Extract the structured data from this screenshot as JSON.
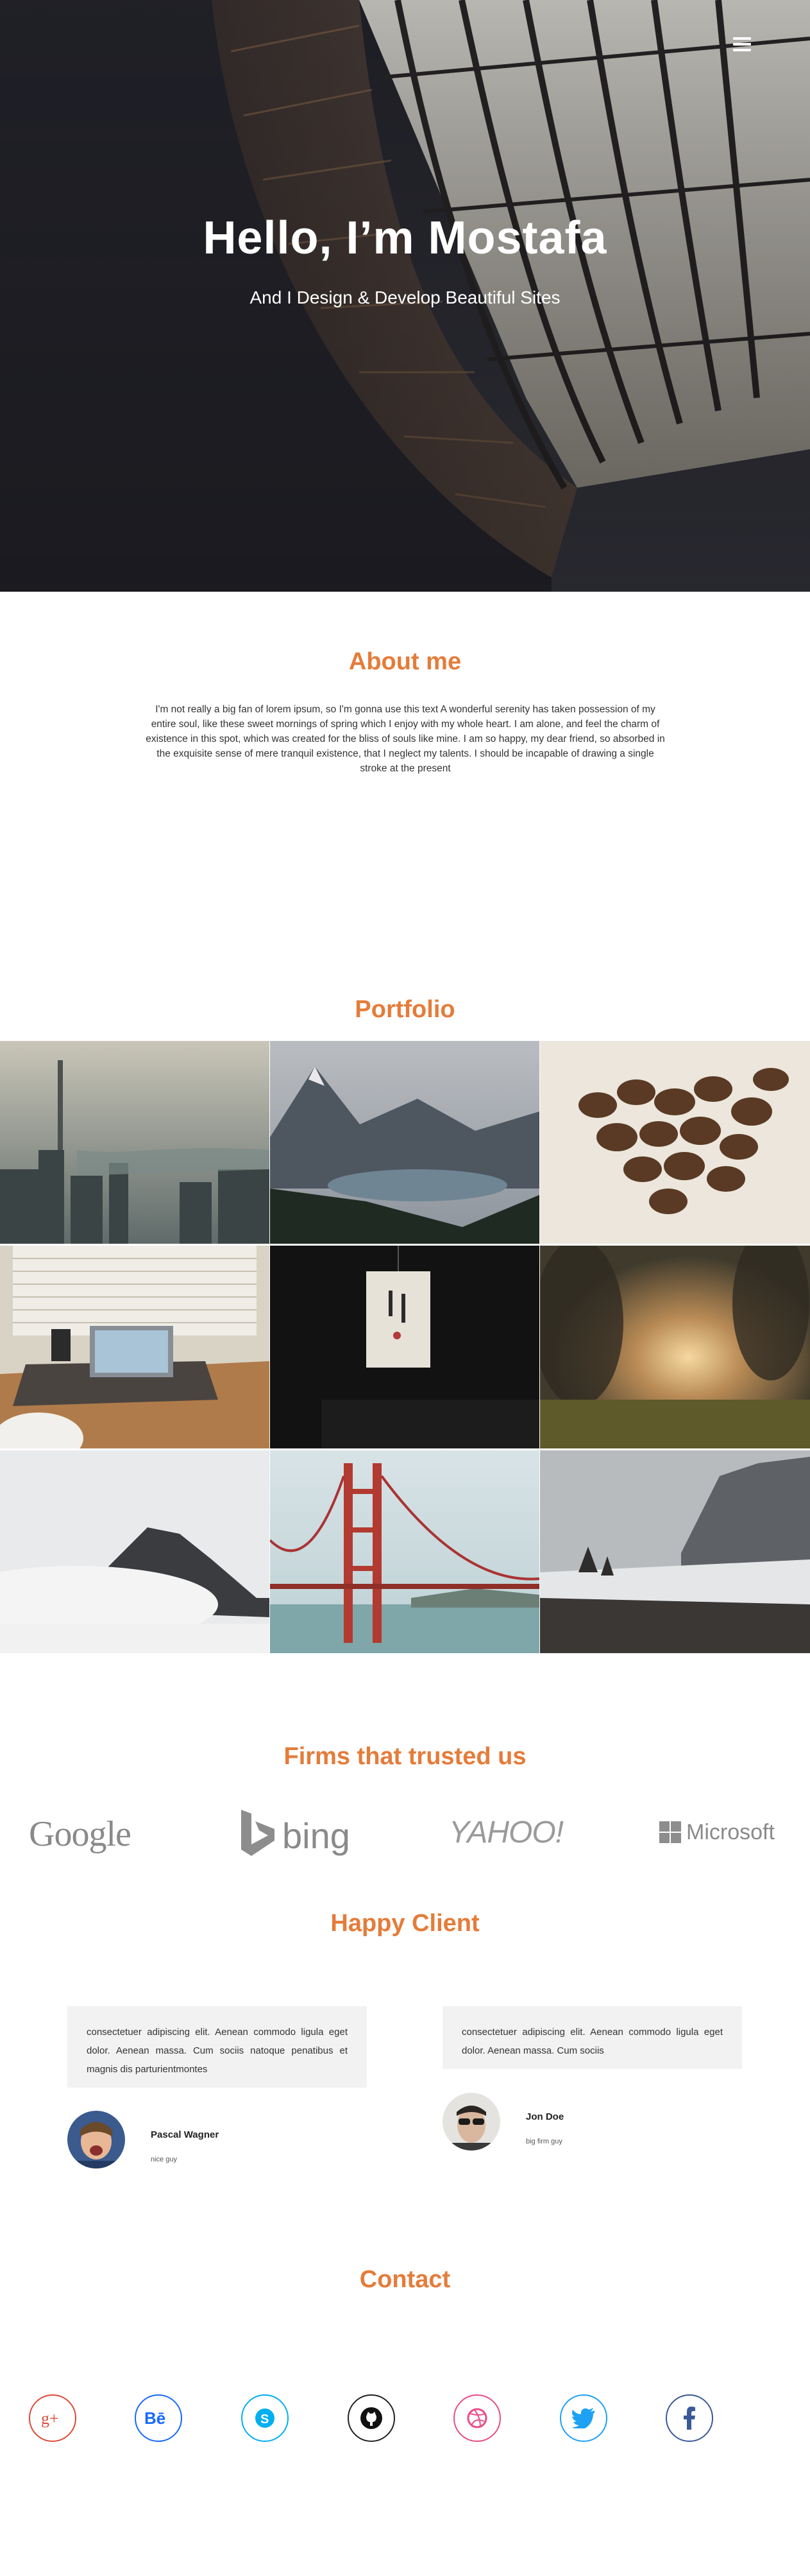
{
  "nav": {
    "menu_icon": "hamburger-menu-icon"
  },
  "hero": {
    "title": "Hello, I’m Mostafa",
    "subtitle": "And I Design & Develop Beautiful Sites"
  },
  "about": {
    "title": "About me",
    "text": "I'm not really a big fan of lorem ipsum, so I'm gonna use this text A wonderful serenity has taken possession of my entire soul, like these sweet mornings of spring which I enjoy with my whole heart. I am alone, and feel the charm of existence in this spot, which was created for the bliss of souls like mine. I am so happy, my dear friend, so absorbed in the exquisite sense of mere tranquil existence, that I neglect my talents. I should be incapable of drawing a single stroke at the present"
  },
  "portfolio": {
    "title": "Portfolio",
    "items": [
      "city-skyline",
      "mountain-lake",
      "coffee-beans",
      "laptop-desk",
      "paper-lantern",
      "sunset-field",
      "misty-mountain",
      "golden-gate-bridge",
      "rocky-coast"
    ]
  },
  "firms": {
    "title": "Firms that trusted us",
    "logos": {
      "google": "Google",
      "bing": "bing",
      "yahoo": "YAHOO!",
      "microsoft": "Microsoft"
    }
  },
  "clients": {
    "title": "Happy Client",
    "items": [
      {
        "quote": "consectetuer adipiscing elit. Aenean commodo ligula eget dolor. Aenean massa. Cum sociis natoque penatibus et magnis dis parturientmontes",
        "name": "Pascal Wagner",
        "role": "nice guy"
      },
      {
        "quote": "consectetuer adipiscing elit. Aenean commodo ligula eget dolor. Aenean massa. Cum sociis",
        "name": "Jon Doe",
        "role": "big firm guy"
      }
    ]
  },
  "contact": {
    "title": "Contact",
    "socials": [
      {
        "name": "google-plus",
        "color": "#dd4b39"
      },
      {
        "name": "behance",
        "color": "#1769ff"
      },
      {
        "name": "skype",
        "color": "#00aff0"
      },
      {
        "name": "github",
        "color": "#222222"
      },
      {
        "name": "dribbble",
        "color": "#ea4c89"
      },
      {
        "name": "twitter",
        "color": "#1da1f2"
      },
      {
        "name": "facebook",
        "color": "#3b5998"
      }
    ]
  },
  "colors": {
    "accent": "#e57c3a",
    "quote_bg": "#f2f2f2",
    "logo_gray": "#8a8a8a"
  }
}
